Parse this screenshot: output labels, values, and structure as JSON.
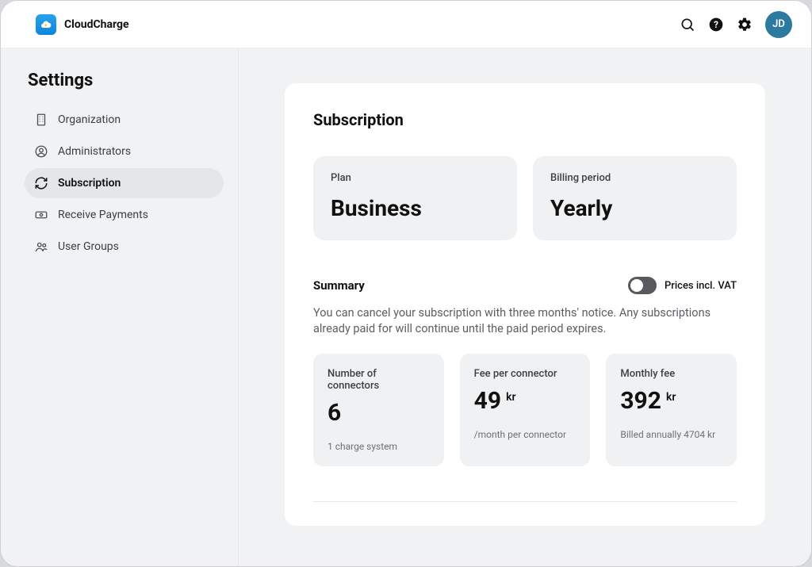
{
  "brand": {
    "name": "CloudCharge"
  },
  "user": {
    "initials": "JD"
  },
  "sidebar": {
    "title": "Settings",
    "items": [
      {
        "label": "Organization"
      },
      {
        "label": "Administrators"
      },
      {
        "label": "Subscription"
      },
      {
        "label": "Receive Payments"
      },
      {
        "label": "User Groups"
      }
    ]
  },
  "page": {
    "heading": "Subscription",
    "plan_label": "Plan",
    "plan_value": "Business",
    "period_label": "Billing period",
    "period_value": "Yearly",
    "summary_heading": "Summary",
    "vat_label": "Prices incl. VAT",
    "summary_desc": "You can cancel your subscription with three months' notice. Any subscriptions already paid for will continue until the paid period expires.",
    "stats": {
      "connectors_label": "Number of connectors",
      "connectors_value": "6",
      "connectors_sub": "1 charge system",
      "fee_label": "Fee per connector",
      "fee_value": "49",
      "fee_unit": "kr",
      "fee_sub": "/month per connector",
      "monthly_label": "Monthly fee",
      "monthly_value": "392",
      "monthly_unit": "kr",
      "monthly_sub": "Billed annually 4704 kr"
    }
  }
}
